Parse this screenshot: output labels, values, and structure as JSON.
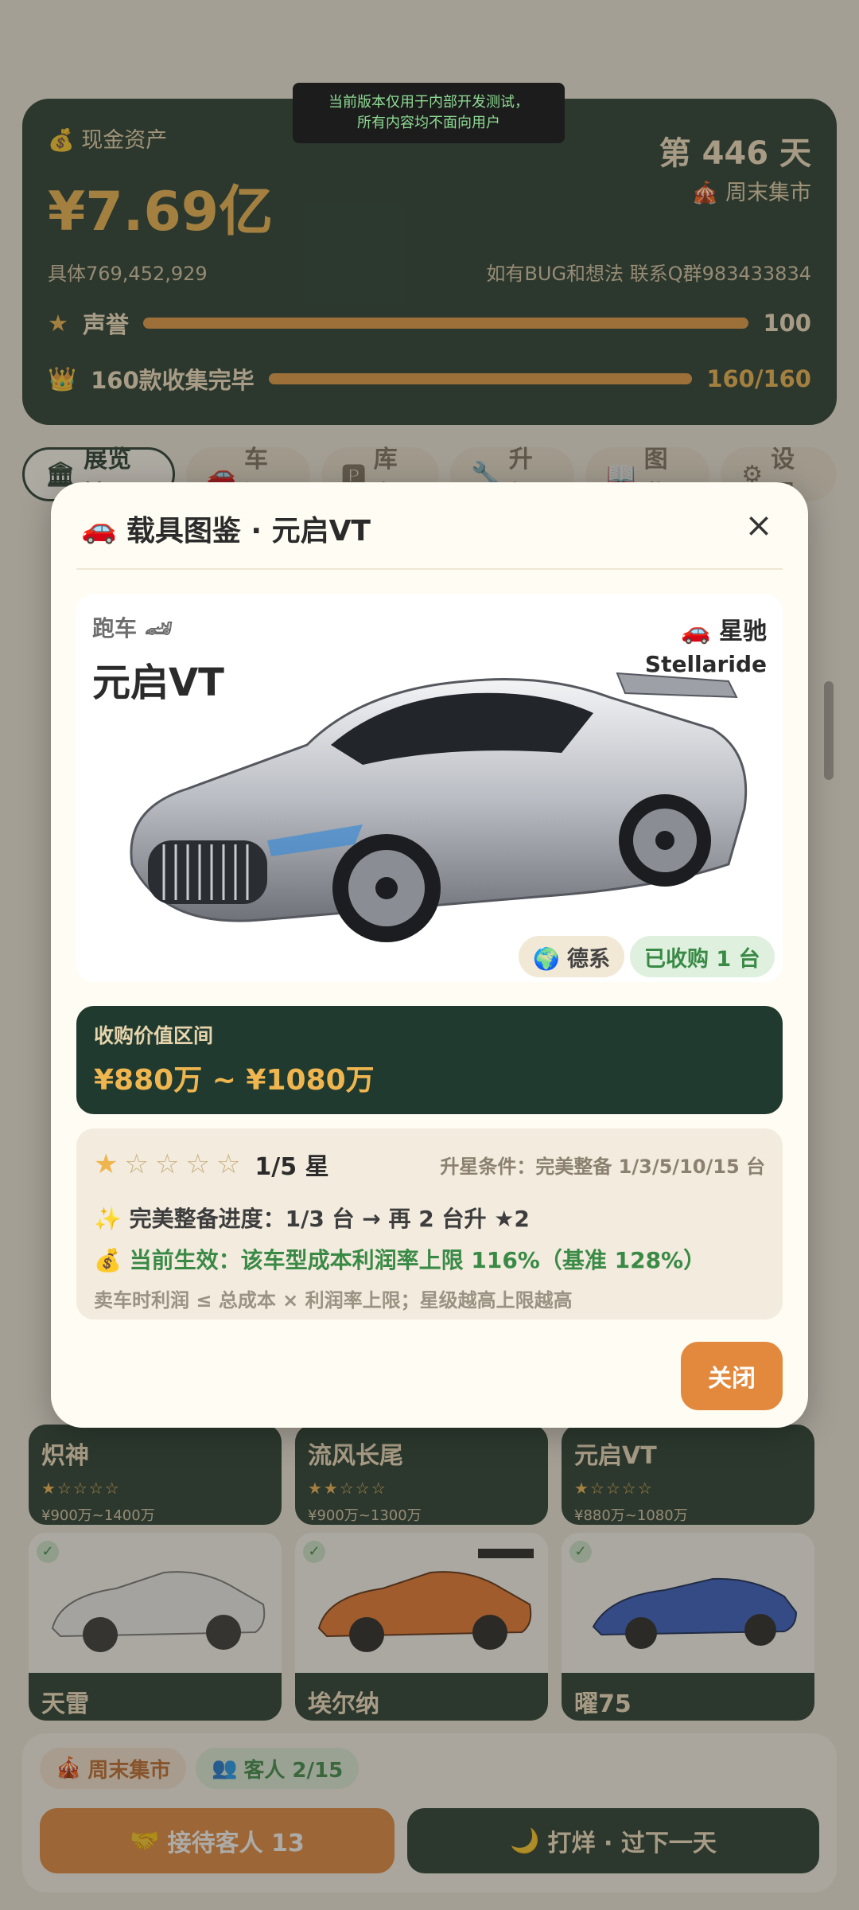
{
  "notice": {
    "line1": "当前版本仅用于内部开发测试，",
    "line2": "所有内容均不面向用户"
  },
  "stats": {
    "cash_label": "现金资产",
    "cash": "¥7.69亿",
    "cash_detail": "具体769,452,929",
    "day": "第 446 天",
    "market": "周末集市",
    "bug_contact": "如有BUG和想法 联系Q群983433834",
    "reputation_label": "声誉",
    "reputation_value": "100",
    "reputation_fill": 1.0,
    "collection_label": "160款收集完毕",
    "collection_value": "160/160",
    "collection_fill": 1.0
  },
  "tabs": [
    {
      "icon": "🏛",
      "label": "展览馆"
    },
    {
      "icon": "🚗",
      "label": "车源"
    },
    {
      "icon": "🅿",
      "label": "库存"
    },
    {
      "icon": "🔧",
      "label": "升级"
    },
    {
      "icon": "📖",
      "label": "图鉴"
    },
    {
      "icon": "⚙",
      "label": "设置"
    }
  ],
  "cards": [
    {
      "name": "炽神",
      "stars": "★☆☆☆☆",
      "range": "¥900万~1400万"
    },
    {
      "name": "流风长尾",
      "stars": "★★☆☆☆",
      "range": "¥900万~1300万"
    },
    {
      "name": "元启VT",
      "stars": "★☆☆☆☆",
      "range": "¥880万~1080万"
    },
    {
      "name": "天雷"
    },
    {
      "name": "埃尔纳"
    },
    {
      "name": "曜75"
    }
  ],
  "bottom": {
    "market_chip": "周末集市",
    "customer_chip": "客人 2/15",
    "serve_button": "接待客人 13",
    "close_shop_button": "打烊 · 过下一天"
  },
  "modal": {
    "title_icon": "🚗",
    "title": "载具图鉴 · 元启VT",
    "car_type": "跑车 🏎",
    "car_name": "元启VT",
    "brand": "🚗 星驰",
    "brand_sub": "Stellaride",
    "origin_tag": "🌍 德系",
    "owned_tag": "已收购 1 台",
    "value_label": "收购价值区间",
    "value_range": "¥880万 ~ ¥1080万",
    "star_level": "1/5 星",
    "star_count": 1,
    "star_condition": "升星条件：完美整备 1/3/5/10/15 台",
    "progress": "✨ 完美整备进度：1/3 台 → 再 2 台升 ★2",
    "effect": "💰 当前生效：该车型成本利润率上限 116%（基准 128%）",
    "note": "卖车时利润 ≤ 总成本 × 利润率上限；星级越高上限越高",
    "close_button": "关闭"
  },
  "colors": {
    "dark_green": "#213a2f",
    "gold": "#efb64f",
    "orange": "#e2893e",
    "cream": "#fffcf3",
    "success": "#3a8a46"
  }
}
